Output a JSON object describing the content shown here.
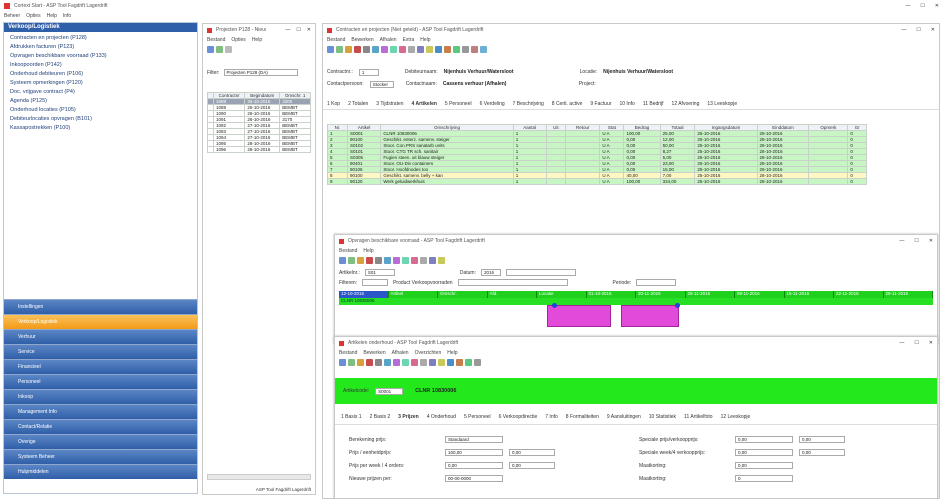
{
  "main_window": {
    "title": "Cortext Start - ASP Tool Fagdrift Lagerdrift",
    "menu": [
      "Beheer",
      "Opties",
      "Help",
      "Info"
    ]
  },
  "nav_panel": {
    "header": "Verkoop/Logistiek",
    "items": [
      "Contracten en projecten (P128)",
      "Afdrukken facturen (P123)",
      "Opvragen beschikbare voorraad (P133)",
      "Inkoopoorden (P142)",
      "Onderhoud debiteuren (P106)",
      "Systeem opmerkingen (P120)",
      "Doc. vrijgave contract (P4)",
      "Agenda (P125)",
      "Onderhoud locaties (P105)",
      "Debiteurlocaties opvragen (B101)",
      "Kassapostrekken (P100)"
    ],
    "sections": [
      "Instellingen",
      "Verkoop/Logistiek",
      "Verhuur",
      "Service",
      "Financieel",
      "Personeel",
      "Inkoop",
      "Management Info",
      "Contact/Relatie",
      "Overige",
      "Systeem Beheer",
      "Hulpmiddelen"
    ]
  },
  "projects_window": {
    "title": "Projecten P128 - Nieuwe",
    "menu": [
      "Bestand",
      "Opties",
      "Help"
    ],
    "filter_label": "Filter:",
    "filter_value": "Projecten P128 (DA)",
    "columns": [
      "Contractnr",
      "Begindatum",
      "Omschr. 1"
    ],
    "rows": [
      [
        "1088",
        "26-10-2016",
        "3200"
      ],
      [
        "1089",
        "26-10-2016",
        "BEMBT"
      ],
      [
        "1090",
        "26-10-2016",
        "BEMBT"
      ],
      [
        "1091",
        "26-10-2016",
        "3170"
      ],
      [
        "1092",
        "27-10-2016",
        "BEMBT"
      ],
      [
        "1093",
        "27-10-2016",
        "BEMBT"
      ],
      [
        "1094",
        "27-10-2016",
        "BEMBT"
      ],
      [
        "1095",
        "28-10-2016",
        "BEMBT"
      ],
      [
        "1096",
        "28-10-2016",
        "BEMBT"
      ]
    ],
    "status": "ASP Tool Fagdrift Lagerdrift"
  },
  "contract_window": {
    "title": "Contracten en projecten (Niet geteld) - ASP Tool Fagdrift Lagerdrift",
    "menu": [
      "Bestand",
      "Bewerken",
      "Afhalen",
      "Extra",
      "Help"
    ],
    "contract_label": "Contractnr.:",
    "contract_value": "1",
    "debiteur_label": "Debiteurnaam:",
    "debiteur_value": "Nijenhuis Verhuur/Watersloot",
    "locatie_label": "Locatie:",
    "locatie_value": "Nijenhuis Verhuur/Watersloot",
    "contact_label": "Contactpersoon:",
    "contact_value": "Stocker",
    "contactname_label": "Contactnaam:",
    "contactname_value": "Cassens verhuur (Afhalen)",
    "project_label": "Project:",
    "tabs": [
      "1 Kop",
      "2 Totalen",
      "3 Tijdstraten",
      "4 Artikelen",
      "5 Personeel",
      "6 Verdeling",
      "7 Beschrijving",
      "8 Certi. active",
      "9 Factuur",
      "10 Info",
      "11 Bedrijf",
      "12 Afvoering",
      "13 Leeskopje"
    ],
    "columns": [
      "Nr.",
      "Artikel",
      "Omschrijving",
      "Aantal",
      "Uit",
      "Retour",
      "Stat",
      "Bedrag",
      "Totaal",
      "Ingangsdatum",
      "Einddatum",
      "Opmerk",
      "Gr"
    ],
    "rows": [
      {
        "c": [
          "1",
          "S0001",
          "CLNR 10830006",
          "1",
          "",
          "",
          "U A",
          "100,00",
          "25,00",
          "25-10-2016",
          "28-10-2016",
          "",
          "0"
        ],
        "s": "g"
      },
      {
        "c": [
          "2",
          "90100",
          "Geschikt. enterz. samenv. steiger",
          "1",
          "",
          "",
          "U A",
          "0,00",
          "12,00",
          "25-10-2016",
          "28-10-2016",
          "",
          "0"
        ],
        "s": "g"
      },
      {
        "c": [
          "3",
          "S0102",
          "Stoor. Con.PRS sanatarb units",
          "1",
          "",
          "",
          "U A",
          "0,00",
          "50,00",
          "25-10-2016",
          "28-10-2016",
          "",
          "0"
        ],
        "s": "g"
      },
      {
        "c": [
          "4",
          "S0101",
          "Stoor. CTG TR sch. sanitair",
          "1",
          "",
          "",
          "U A",
          "0,00",
          "8,27",
          "25-10-2016",
          "28-10-2016",
          "",
          "0"
        ],
        "s": "g"
      },
      {
        "c": [
          "5",
          "S0305",
          "Fugien steen. uit blauw steiger",
          "1",
          "",
          "",
          "U A",
          "0,00",
          "5,00",
          "25-10-2016",
          "28-10-2016",
          "",
          "0"
        ],
        "s": "g"
      },
      {
        "c": [
          "6",
          "90401",
          "Stoor. OU-Div containers",
          "1",
          "",
          "",
          "U A",
          "0,00",
          "23,00",
          "25-10-2016",
          "28-10-2016",
          "",
          "0"
        ],
        "s": "g"
      },
      {
        "c": [
          "7",
          "90106",
          "Stoor. Hoofdnodes too",
          "1",
          "",
          "",
          "U A",
          "0,00",
          "15,00",
          "25-10-2016",
          "28-10-2016",
          "",
          "0"
        ],
        "s": "g"
      },
      {
        "c": [
          "8",
          "90100",
          "Geschikt. samenv. belly + kan",
          "1",
          "",
          "",
          "U A",
          "40,00",
          "7,00",
          "25-10-2016",
          "28-10-2016",
          "",
          "0"
        ],
        "s": "y"
      },
      {
        "c": [
          "9",
          "90120",
          "Werk geluidwerkhuis",
          "1",
          "",
          "",
          "U A",
          "100,00",
          "334,00",
          "25-10-2016",
          "28-10-2016",
          "",
          "0"
        ],
        "s": "g"
      }
    ]
  },
  "planning_window": {
    "title": "Opvragen beschikbare voorraad - ASP Tool Fagdrift Lagerdrift",
    "menu": [
      "Bestand",
      "Help"
    ],
    "artikel_label": "Artikelnr.:",
    "artikel_value": "S01",
    "datum_label": "Datum:",
    "datum_value": "2016",
    "filter_label": "Filteren:",
    "view_label": "Product Verkoopvoorraden",
    "periode_label": "Periode:",
    "header_cells": [
      "12-10-2016",
      "Artikel",
      "Omschr.",
      "Afd.",
      "Locatie",
      "01-10-2016",
      "20-11-2016",
      "28-11-2016",
      "08-11-2016",
      "15-11-2016",
      "22-11-2016",
      "29-11-2016"
    ],
    "row_label": "CLNR 10830006"
  },
  "article_window": {
    "title": "Artikelen onderhoud - ASP Tool Fagdrift Lagerdrift",
    "menu": [
      "Bestand",
      "Bewerken",
      "Afhalen",
      "Overzichten",
      "Help"
    ],
    "code_label": "Artikelcode:",
    "code_value": "S0001",
    "name_value": "CLNR 10830006",
    "tabs": [
      "1 Basis 1",
      "2 Basis 2",
      "3 Prijzen",
      "4 Onderhoud",
      "5 Personeel",
      "6 Verkoopdirectie",
      "7 Info",
      "8 Formaliteiten",
      "9 Aansluitingen",
      "10 Statistiek",
      "11 Artikelfoto",
      "12 Leeskopje"
    ],
    "left_fields": [
      {
        "label": "Berekening prijs:",
        "value": "Standaard",
        "value2": ""
      },
      {
        "label": "Prijs / eenheidprijs:",
        "value": "100,00",
        "value2": "0,00"
      },
      {
        "label": "Prijs per week / 4 orders:",
        "value": "0,00",
        "value2": "0,00"
      },
      {
        "label": "Nieuwe prijzen per:",
        "value": "00-00-0000",
        "value2": ""
      }
    ],
    "right_fields": [
      {
        "label": "Speciale prijs/verkoopprijs:",
        "value": "0,00",
        "value2": "0,00"
      },
      {
        "label": "Speciale week/4 verkoopprijs:",
        "value": "0,00",
        "value2": "0,00"
      },
      {
        "label": "Maatkorting:",
        "value": "0,00",
        "value2": ""
      },
      {
        "label": "Maatkorting:",
        "value": "0",
        "value2": ""
      }
    ]
  },
  "colors": {
    "accent_orange": "#f7a21b",
    "nav_blue": "#3a6fb6",
    "green_bar": "#22e81c",
    "row_green": "#c7f5c3",
    "magenta": "#e24ad9"
  }
}
